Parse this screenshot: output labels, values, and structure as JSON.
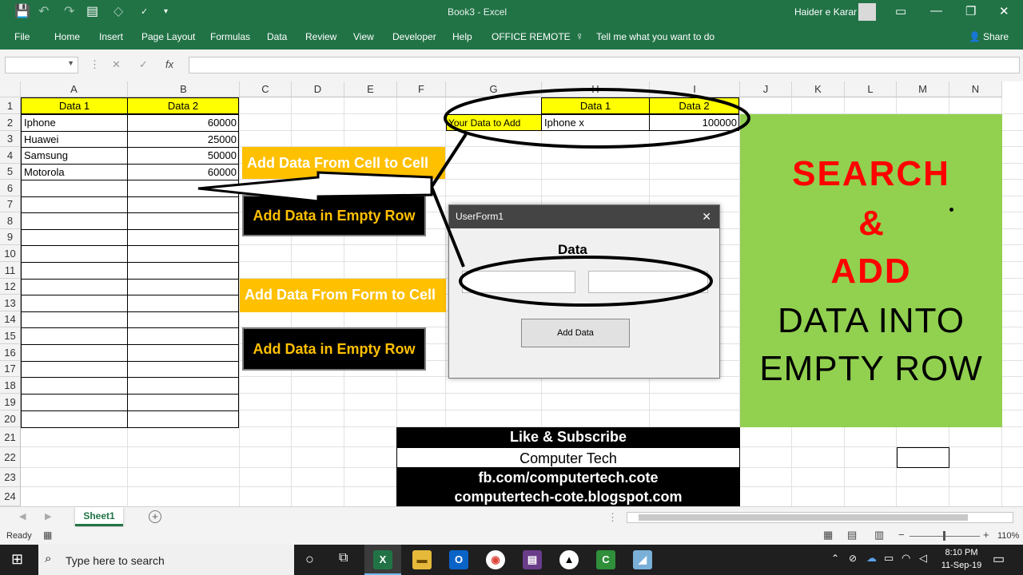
{
  "window": {
    "title": "Book3  -  Excel",
    "user": "Haider e Karar"
  },
  "ribbon": {
    "tabs": [
      "File",
      "Home",
      "Insert",
      "Page Layout",
      "Formulas",
      "Data",
      "Review",
      "View",
      "Developer",
      "Help",
      "OFFICE REMOTE"
    ],
    "tell_me": "Tell me what you want to do",
    "share": "Share"
  },
  "formula_bar": {
    "fx": "fx",
    "cancel": "✕",
    "enter": "✓"
  },
  "grid": {
    "columns": [
      "A",
      "B",
      "C",
      "D",
      "E",
      "F",
      "G",
      "H",
      "I",
      "J",
      "K",
      "L",
      "M",
      "N"
    ],
    "rows": [
      "1",
      "2",
      "3",
      "4",
      "5",
      "6",
      "7",
      "8",
      "9",
      "10",
      "11",
      "12",
      "13",
      "14",
      "15",
      "16",
      "17",
      "18",
      "19",
      "20",
      "21",
      "22",
      "23",
      "24"
    ]
  },
  "table1": {
    "headers": [
      "Data 1",
      "Data 2"
    ],
    "rows": [
      [
        "Iphone",
        "60000"
      ],
      [
        "Huawei",
        "25000"
      ],
      [
        "Samsung",
        "50000"
      ],
      [
        "Motorola",
        "60000"
      ]
    ]
  },
  "table2": {
    "label": "Your Data to Add",
    "headers": [
      "Data 1",
      "Data 2"
    ],
    "values": [
      "Iphone x",
      "100000"
    ]
  },
  "buttons": {
    "cell_to_cell": "Add Data From Cell to Cell",
    "empty_row_1": "Add Data in Empty Row",
    "form_to_cell": "Add Data From Form to Cell",
    "empty_row_2": "Add Data in Empty Row"
  },
  "userform": {
    "title": "UserForm1",
    "close": "✕",
    "label": "Data",
    "add_button": "Add Data"
  },
  "promo": {
    "line1": "SEARCH",
    "line2": "&",
    "line3": "ADD",
    "line4": "DATA INTO",
    "line5": "EMPTY ROW"
  },
  "banners": [
    "Like & Subscribe",
    "Computer Tech",
    "fb.com/computertech.cote",
    "computertech-cote.blogspot.com"
  ],
  "sheet_tabs": {
    "active": "Sheet1",
    "add": "+"
  },
  "status": {
    "ready": "Ready",
    "zoom": "110%"
  },
  "taskbar": {
    "search_placeholder": "Type here to search",
    "time": "8:10 PM",
    "date": "11-Sep-19"
  },
  "colors": {
    "excel_green": "#217346",
    "yellow": "#ffff00",
    "orange": "#ffc000",
    "promo_green": "#92d050",
    "promo_red": "#ff0000"
  }
}
